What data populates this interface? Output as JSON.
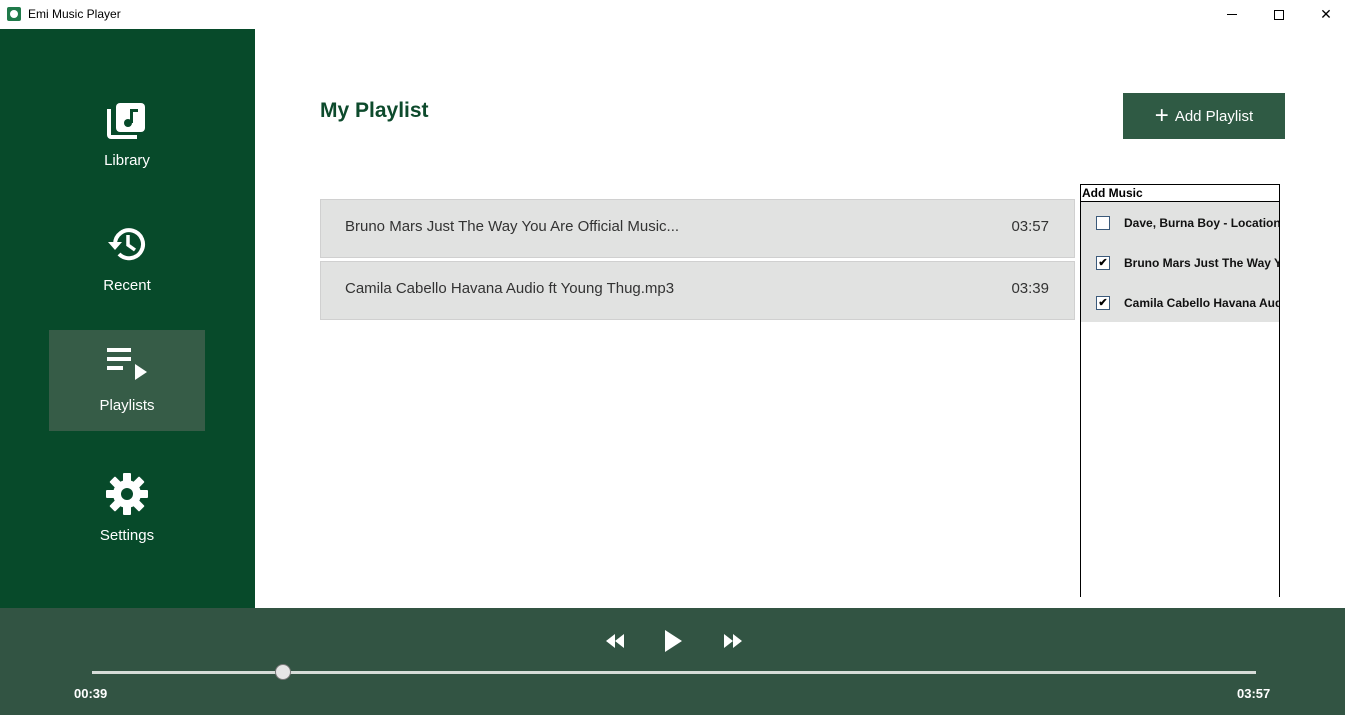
{
  "window": {
    "title": "Emi Music Player",
    "close_symbol": "✕"
  },
  "sidebar": {
    "items": [
      {
        "label": "Library",
        "icon": "library-music-icon",
        "active": false
      },
      {
        "label": "Recent",
        "icon": "history-icon",
        "active": false
      },
      {
        "label": "Playlists",
        "icon": "playlist-play-icon",
        "active": true
      },
      {
        "label": "Settings",
        "icon": "gear-icon",
        "active": false
      }
    ]
  },
  "main": {
    "title": "My Playlist",
    "add_button": {
      "label": "Add Playlist",
      "icon": "plus-icon"
    },
    "playlist": [
      {
        "title": "Bruno Mars  Just The Way You Are Official Music...",
        "duration": "03:57"
      },
      {
        "title": "Camila Cabello  Havana Audio ft Young Thug.mp3",
        "duration": "03:39"
      }
    ]
  },
  "add_music": {
    "header": "Add Music",
    "items": [
      {
        "label": "Dave, Burna Boy - Location(",
        "checked": false,
        "check_mark": ""
      },
      {
        "label": "Bruno Mars  Just The Way Y",
        "checked": true,
        "check_mark": "✔"
      },
      {
        "label": "Camila Cabello  Havana Aud",
        "checked": true,
        "check_mark": "✔"
      }
    ]
  },
  "player": {
    "current_time": "00:39",
    "total_time": "03:57",
    "progress": 0.164
  },
  "colors": {
    "sidebar_bg": "#074a2a",
    "sidebar_active": "#365c47",
    "player_bg": "#325443",
    "title_color": "#0d4a2c",
    "button_bg": "#2f5a44"
  }
}
